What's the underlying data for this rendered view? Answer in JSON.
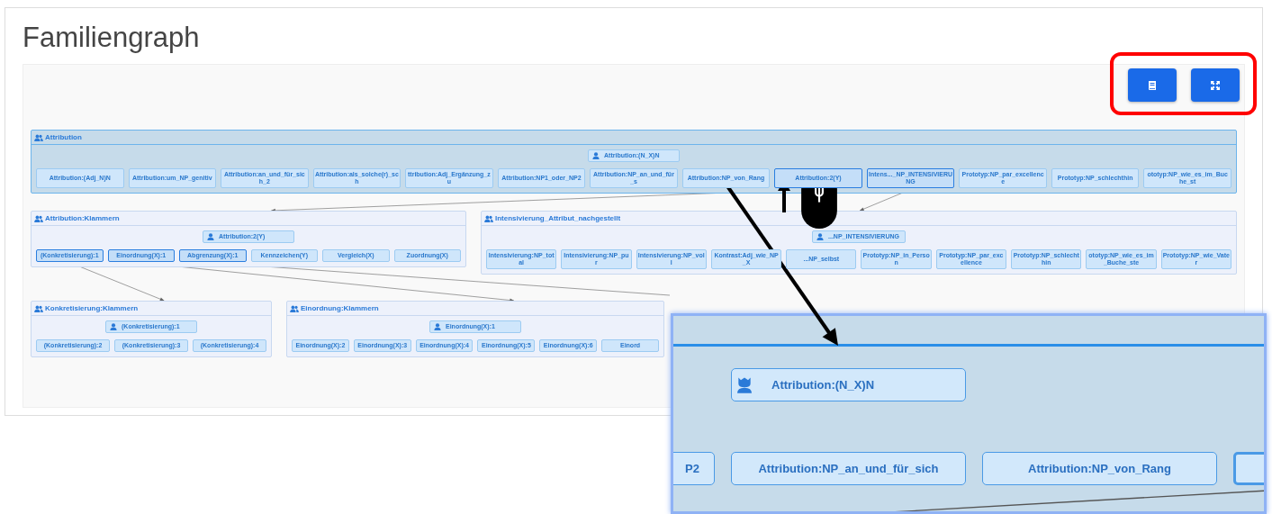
{
  "page": {
    "title": "Familiengraph"
  },
  "toolbar": {
    "buttons": [
      {
        "kind": "legend"
      },
      {
        "kind": "fullscreen"
      }
    ]
  },
  "graph": {
    "groups": [
      {
        "title": "Attribution",
        "head": "Attribution:(N_X)N",
        "nodes": [
          {
            "label": "Attribution:(Adj_N)N",
            "highlighted": false
          },
          {
            "label": "Attribution:um_NP_genitiv",
            "highlighted": false
          },
          {
            "label": "Attribution:an_und_für_sich_2",
            "highlighted": false
          },
          {
            "label": "Attribution:als_solche(r)_sch",
            "highlighted": false
          },
          {
            "label": "ttribution:Adj_Ergänzung_zu",
            "highlighted": false
          },
          {
            "label": "Attribution:NP1_oder_NP2",
            "highlighted": false
          },
          {
            "label": "Attribution:NP_an_und_für_s",
            "highlighted": false
          },
          {
            "label": "Attribution:NP_von_Rang",
            "highlighted": false
          },
          {
            "label": "Attribution:2(Y)",
            "highlighted": true
          },
          {
            "label": "Intens..._NP_INTENSIVIERUNG",
            "highlighted": true
          },
          {
            "label": "Prototyp:NP_par_excellence",
            "highlighted": false
          },
          {
            "label": "Prototyp:NP_schlechthin",
            "highlighted": false
          },
          {
            "label": "ototyp:NP_wie_es_im_Buche_st",
            "highlighted": false
          }
        ]
      },
      {
        "title": "Attribution:Klammern",
        "head": "Attribution:2(Y)",
        "nodes": [
          {
            "label": "(Konkretisierung):1",
            "highlighted": true
          },
          {
            "label": "Einordnung(X):1",
            "highlighted": true
          },
          {
            "label": "Abgrenzung(X):1",
            "highlighted": true
          },
          {
            "label": "Kennzeichen(Y)",
            "highlighted": false
          },
          {
            "label": "Vergleich(X)",
            "highlighted": false
          },
          {
            "label": "Zuordnung(X)",
            "highlighted": false
          }
        ]
      },
      {
        "title": "Intensivierung_Attribut_nachgestellt",
        "head": "...NP_INTENSIVIERUNG",
        "nodes": [
          {
            "label": "Intensivierung:NP_total",
            "highlighted": false
          },
          {
            "label": "Intensivierung:NP_pur",
            "highlighted": false
          },
          {
            "label": "Intensivierung:NP_voll",
            "highlighted": false
          },
          {
            "label": "Kontrast:Adj_wie_NP_X",
            "highlighted": false
          },
          {
            "label": "...NP_selbst",
            "highlighted": false
          },
          {
            "label": "Prototyp:NP_in_Person",
            "highlighted": false
          },
          {
            "label": "Prototyp:NP_par_excellence",
            "highlighted": false
          },
          {
            "label": "Prototyp:NP_schlechthin",
            "highlighted": false
          },
          {
            "label": "ototyp:NP_wie_es_im_Buche_ste",
            "highlighted": false
          },
          {
            "label": "Prototyp:NP_wie_Vater",
            "highlighted": false
          }
        ]
      },
      {
        "title": "Konkretisierung:Klammern",
        "head": "(Konkretisierung):1",
        "nodes": [
          {
            "label": "(Konkretisierung):2",
            "highlighted": false
          },
          {
            "label": "(Konkretisierung):3",
            "highlighted": false
          },
          {
            "label": "(Konkretisierung):4",
            "highlighted": false
          }
        ]
      },
      {
        "title": "Einordnung:Klammern",
        "head": "Einordnung(X):1",
        "nodes": [
          {
            "label": "Einordnung(X):2",
            "highlighted": false
          },
          {
            "label": "Einordnung(X):3",
            "highlighted": false
          },
          {
            "label": "Einordnung(X):4",
            "highlighted": false
          },
          {
            "label": "Einordnung(X):5",
            "highlighted": false
          },
          {
            "label": "Einordnung(X):6",
            "highlighted": false
          },
          {
            "label": "Einord",
            "highlighted": false
          }
        ]
      }
    ]
  },
  "zoom_inset": {
    "head": "Attribution:(N_X)N",
    "nodes": [
      {
        "label": "P2"
      },
      {
        "label": "Attribution:NP_an_und_für_sich"
      },
      {
        "label": "Attribution:NP_von_Rang"
      }
    ]
  }
}
